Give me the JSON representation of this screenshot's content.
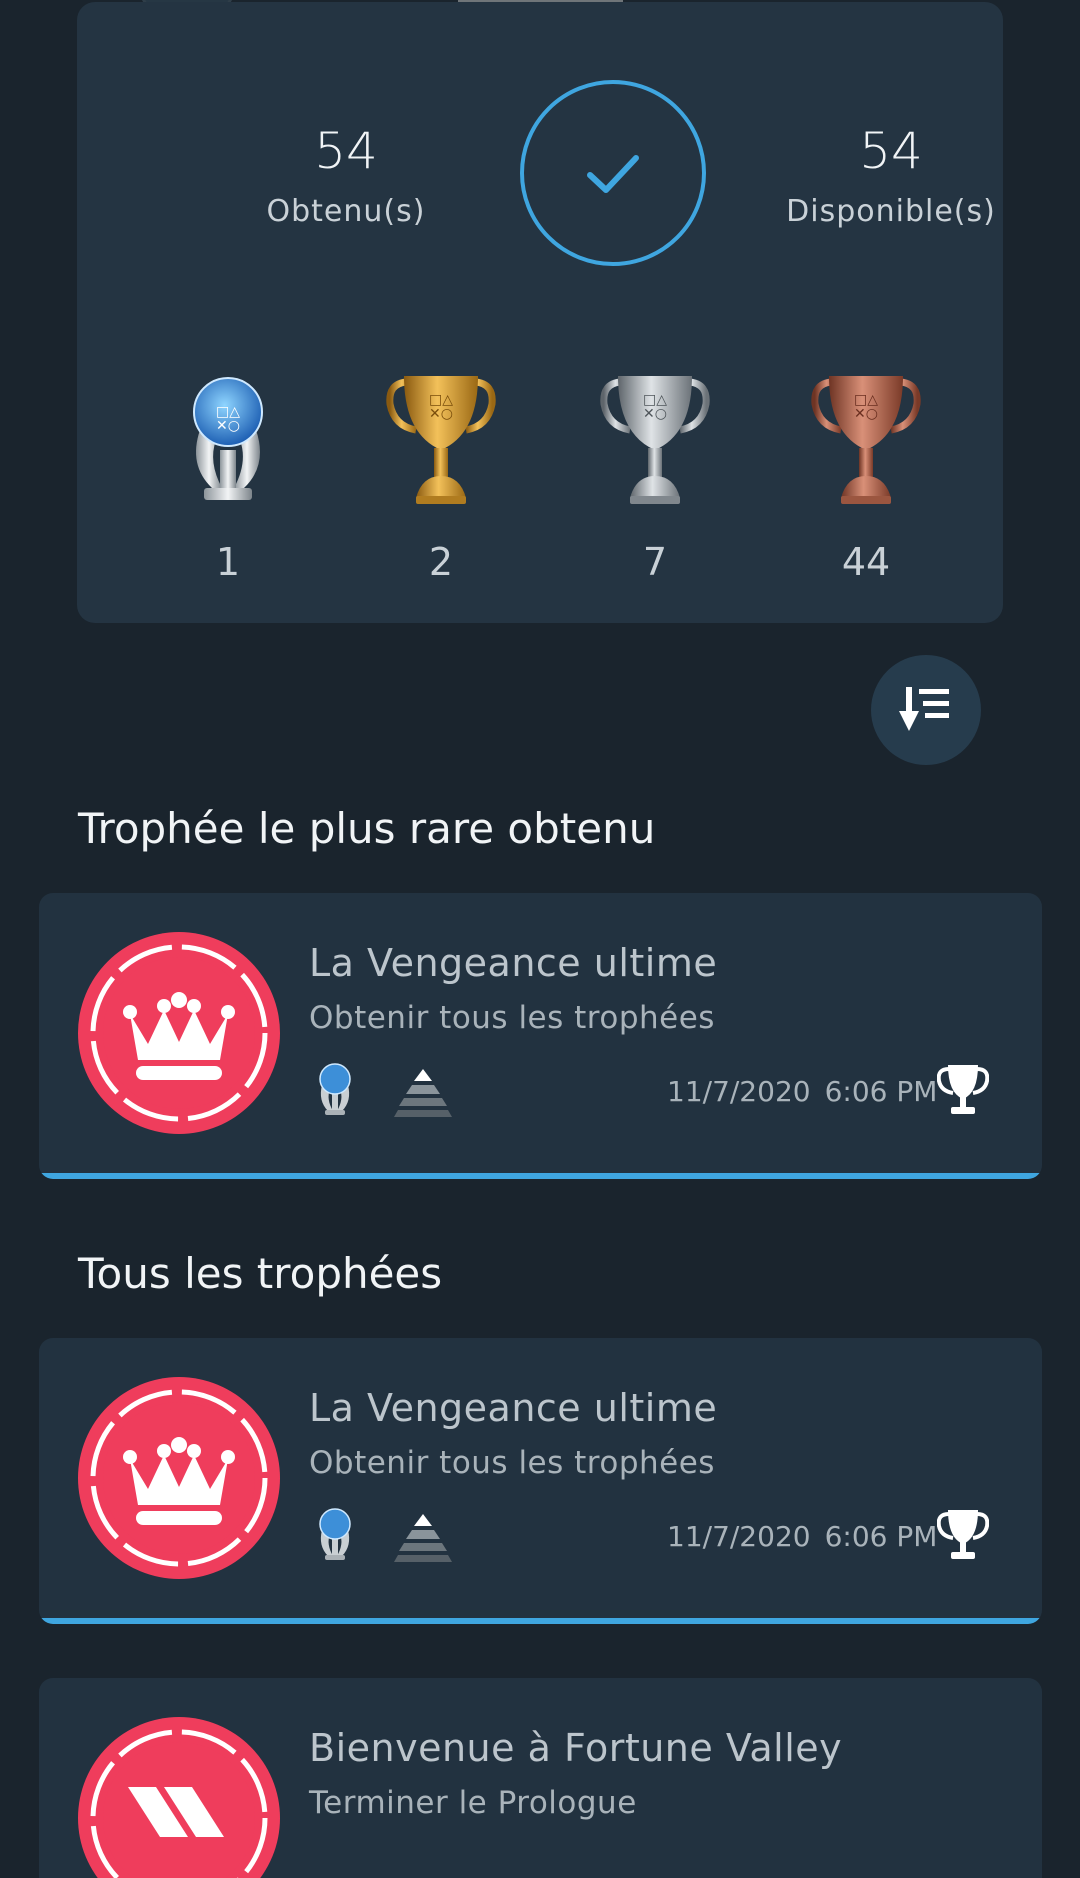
{
  "summary": {
    "earned_count": "54",
    "earned_label": "Obtenu(s)",
    "available_count": "54",
    "available_label": "Disponible(s)",
    "trophy_counts": [
      {
        "type": "platinum",
        "count": "1"
      },
      {
        "type": "gold",
        "count": "2"
      },
      {
        "type": "silver",
        "count": "7"
      },
      {
        "type": "bronze",
        "count": "44"
      }
    ]
  },
  "sections": {
    "rarest_title": "Trophée le plus rare obtenu",
    "all_title": "Tous les trophées"
  },
  "rarest": {
    "name": "La Vengeance ultime",
    "description": "Obtenir tous les trophées",
    "date": "11/7/2020",
    "time": "6:06 PM"
  },
  "trophies": [
    {
      "name": "La Vengeance ultime",
      "description": "Obtenir tous les trophées",
      "date": "11/7/2020",
      "time": "6:06 PM"
    },
    {
      "name": "Bienvenue à Fortune Valley",
      "description": "Terminer le Prologue"
    }
  ],
  "colors": {
    "accent": "#3fa6e0",
    "badge_red": "#ef3d5c",
    "card_bg": "#223240",
    "page_bg": "#1a242d"
  },
  "icons": [
    "check-icon",
    "platinum-trophy-icon",
    "gold-trophy-icon",
    "silver-trophy-icon",
    "bronze-trophy-icon",
    "sort-icon",
    "crown-icon",
    "rarity-pyramid-icon",
    "trophy-cup-icon"
  ]
}
